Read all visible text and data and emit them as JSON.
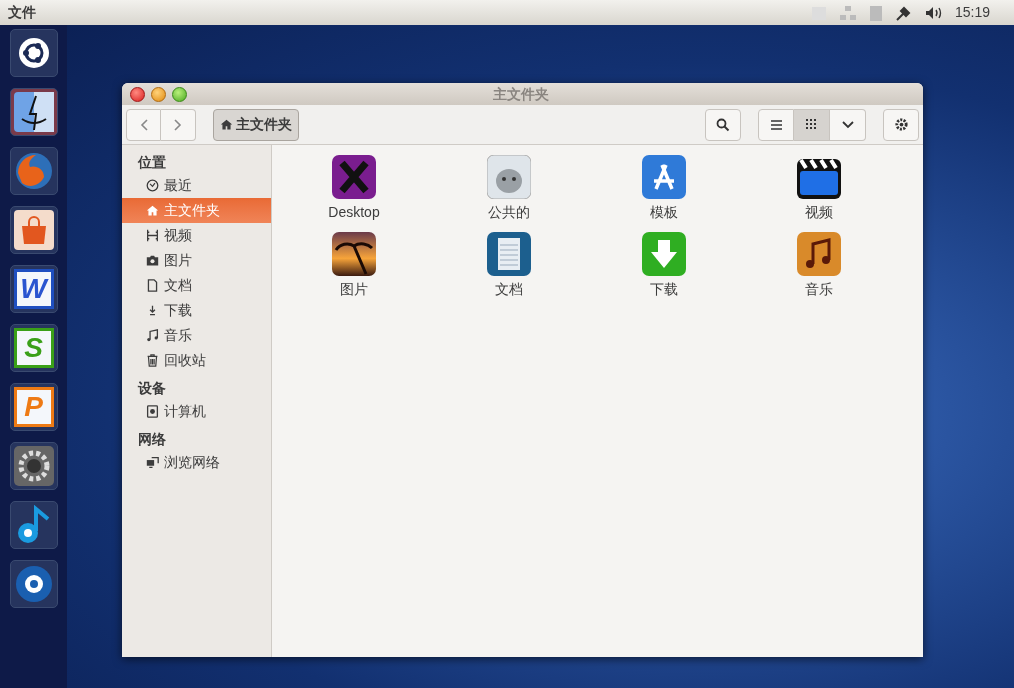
{
  "top_bar": {
    "app_title": "文件",
    "clock": "15:19"
  },
  "launcher": [
    {
      "kind": "ubuntu",
      "active": false
    },
    {
      "kind": "finder",
      "active": true
    },
    {
      "kind": "firefox",
      "active": false
    },
    {
      "kind": "store",
      "active": false
    },
    {
      "kind": "letter",
      "letter": "W",
      "active": false
    },
    {
      "kind": "letter",
      "letter": "S",
      "active": false
    },
    {
      "kind": "letter",
      "letter": "P",
      "active": false
    },
    {
      "kind": "settings",
      "active": false
    },
    {
      "kind": "music",
      "active": false
    },
    {
      "kind": "player",
      "active": false
    }
  ],
  "window": {
    "title": "主文件夹",
    "path_button": "主文件夹"
  },
  "toolbar": {
    "views": [
      {
        "kind": "list",
        "selected": false
      },
      {
        "kind": "grid",
        "selected": true
      }
    ]
  },
  "sidebar": [
    {
      "heading": "位置",
      "items": [
        {
          "kind": "recent",
          "label": "最近",
          "selected": false
        },
        {
          "kind": "home",
          "label": "主文件夹",
          "selected": true
        },
        {
          "kind": "video",
          "label": "视频",
          "selected": false
        },
        {
          "kind": "camera",
          "label": "图片",
          "selected": false
        },
        {
          "kind": "doc",
          "label": "文档",
          "selected": false
        },
        {
          "kind": "download",
          "label": "下载",
          "selected": false
        },
        {
          "kind": "music",
          "label": "音乐",
          "selected": false
        },
        {
          "kind": "trash",
          "label": "回收站",
          "selected": false
        }
      ]
    },
    {
      "heading": "设备",
      "items": [
        {
          "kind": "disk",
          "label": "计算机",
          "selected": false
        }
      ]
    },
    {
      "heading": "网络",
      "items": [
        {
          "kind": "network",
          "label": "浏览网络",
          "selected": false
        }
      ]
    }
  ],
  "files": [
    {
      "kind": "desktop",
      "label": "Desktop"
    },
    {
      "kind": "public",
      "label": "公共的"
    },
    {
      "kind": "templates",
      "label": "模板"
    },
    {
      "kind": "videos",
      "label": "视频"
    },
    {
      "kind": "pictures",
      "label": "图片"
    },
    {
      "kind": "documents",
      "label": "文档"
    },
    {
      "kind": "downloads",
      "label": "下载"
    },
    {
      "kind": "music",
      "label": "音乐"
    }
  ]
}
